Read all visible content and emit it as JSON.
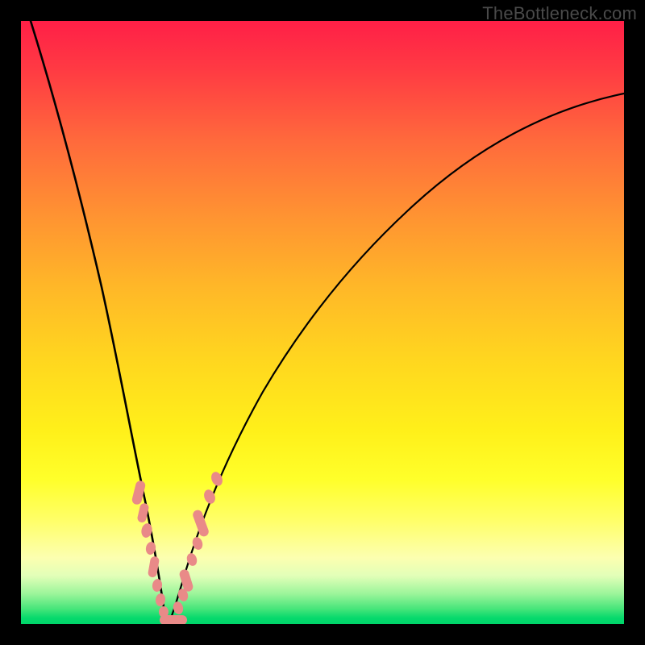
{
  "watermark": "TheBottleneck.com",
  "chart_data": {
    "type": "line",
    "title": "",
    "xlabel": "",
    "ylabel": "",
    "xlim": [
      0,
      100
    ],
    "ylim": [
      0,
      100
    ],
    "grid": false,
    "legend": false,
    "series": [
      {
        "name": "bottleneck-curve",
        "color": "#000000",
        "x": [
          0,
          4,
          8,
          12,
          16,
          18,
          20,
          22,
          23,
          24,
          25,
          26,
          28,
          32,
          36,
          42,
          50,
          58,
          66,
          74,
          82,
          90,
          100
        ],
        "y": [
          100,
          87,
          72,
          56,
          38,
          27,
          16,
          6,
          1,
          0,
          1,
          4,
          11,
          23,
          33,
          45,
          57,
          66,
          73,
          78,
          82,
          85,
          88
        ]
      },
      {
        "name": "marker-cluster",
        "type": "scatter",
        "color": "#e98a88",
        "x": [
          19.2,
          19.9,
          20.7,
          21.4,
          21.8,
          22.3,
          22.7,
          23.2,
          23.6,
          24.0,
          24.5,
          25.1,
          25.8,
          26.6,
          27.6,
          28.8,
          29.6,
          30.4
        ],
        "y": [
          22.0,
          18.0,
          13.5,
          9.5,
          7.0,
          4.5,
          2.5,
          1.0,
          0.3,
          0.0,
          0.5,
          2.0,
          4.5,
          7.5,
          11.0,
          15.5,
          18.5,
          21.5
        ]
      }
    ],
    "annotations": [
      {
        "text": "TheBottleneck.com",
        "position": "top-right"
      }
    ]
  }
}
